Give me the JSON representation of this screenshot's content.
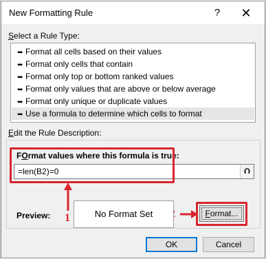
{
  "dialog": {
    "title": "New Formatting Rule",
    "help_glyph": "?",
    "close_glyph": "✕"
  },
  "rule_type": {
    "label_underlined": "S",
    "label_rest": "elect a Rule Type:",
    "items": [
      {
        "label": "Format all cells based on their values",
        "selected": false
      },
      {
        "label": "Format only cells that contain",
        "selected": false
      },
      {
        "label": "Format only top or bottom ranked values",
        "selected": false
      },
      {
        "label": "Format only values that are above or below average",
        "selected": false
      },
      {
        "label": "Format only unique or duplicate values",
        "selected": false
      },
      {
        "label": "Use a formula to determine which cells to format",
        "selected": true
      }
    ]
  },
  "description": {
    "label_underlined": "E",
    "label_rest": "dit the Rule Description:",
    "formula_label_underlined": "O",
    "formula_label_pre": "F",
    "formula_label_rest": "rmat values where this formula is true:",
    "formula_value": "=len(B2)=0",
    "collapse_glyph": "⮉"
  },
  "preview": {
    "label": "Preview:",
    "text": "No Format Set"
  },
  "buttons": {
    "format_underlined": "F",
    "format_rest": "ormat...",
    "ok": "OK",
    "cancel": "Cancel"
  },
  "annotations": {
    "marker1": "1",
    "marker2": "2",
    "color": "#d7262e"
  }
}
